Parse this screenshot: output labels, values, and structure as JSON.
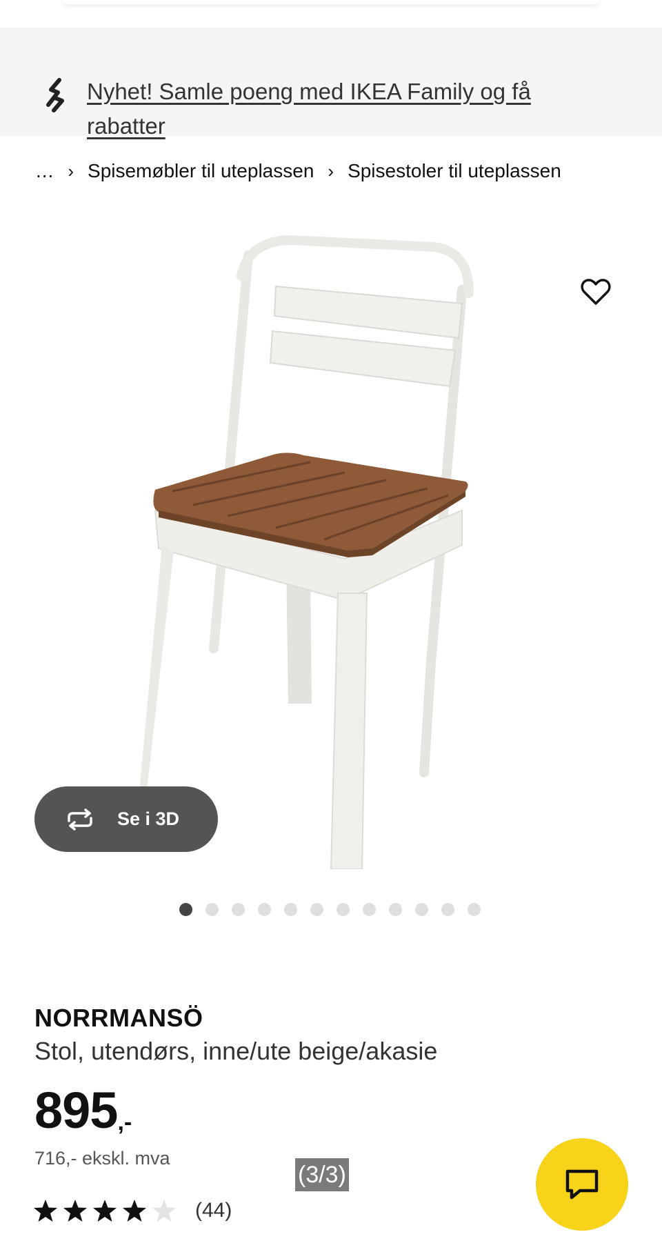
{
  "promo": {
    "icon": "ikea-family-link-icon",
    "link_text": "Nyhet! Samle poeng med IKEA Family og få rabatter"
  },
  "breadcrumb": {
    "ellipsis": "...",
    "separator": "›",
    "items": [
      "Spisemøbler til uteplassen",
      "Spisestoler til uteplassen"
    ]
  },
  "gallery": {
    "favorite_icon": "heart-icon",
    "view_3d_label": "Se i 3D",
    "view_3d_icon": "rotate-3d-icon",
    "image_count": 12,
    "active_index": 0
  },
  "product": {
    "name": "NORRMANSÖ",
    "description": "Stol, utendørs, inne/ute beige/akasie",
    "price": "895",
    "price_suffix": ",-",
    "price_ex_vat": "716,- ekskl. mva",
    "rating": 4,
    "rating_max": 5,
    "review_count": "(44)"
  },
  "overlay": {
    "page_counter": "(3/3)"
  },
  "chat": {
    "icon": "chat-icon"
  },
  "colors": {
    "accent_yellow": "#f7d31a",
    "promo_bg": "#f5f5f5",
    "button_3d_bg": "#545454"
  }
}
